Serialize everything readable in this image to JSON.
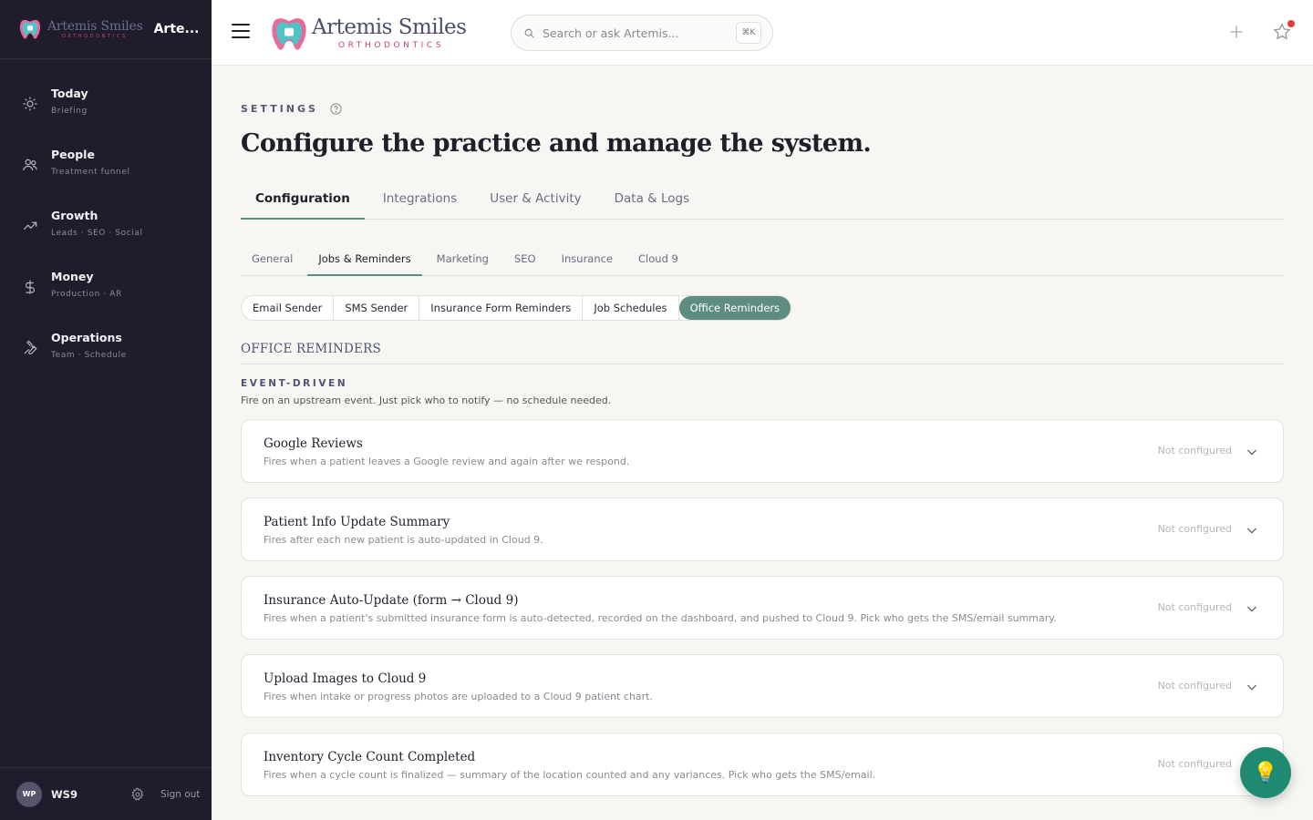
{
  "brand": {
    "logo_name": "Artemis Smiles",
    "logo_tagline": "ORTHODONTICS",
    "app_name": "Arte...",
    "colors": {
      "accent": "#5d8c83",
      "sidebar_bg": "#1f1d2b",
      "brand_pink": "#c8426f",
      "fab": "#1e8a72"
    }
  },
  "sidebar": {
    "items": [
      {
        "label": "Today",
        "sub": "Briefing",
        "icon": "sun-icon"
      },
      {
        "label": "People",
        "sub": "Treatment funnel",
        "icon": "people-icon"
      },
      {
        "label": "Growth",
        "sub": "Leads · SEO · Social",
        "icon": "trending-up-icon"
      },
      {
        "label": "Money",
        "sub": "Production · AR",
        "icon": "dollar-icon"
      },
      {
        "label": "Operations",
        "sub": "Team · Schedule",
        "icon": "wrench-icon"
      }
    ],
    "user": {
      "initials": "WP",
      "name": "WS9",
      "signout": "Sign out"
    }
  },
  "topbar": {
    "search_placeholder": "Search or ask Artemis...",
    "shortcut": "⌘K"
  },
  "page": {
    "overline": "SETTINGS",
    "title": "Configure the practice and manage the system."
  },
  "tabs": [
    "Configuration",
    "Integrations",
    "User & Activity",
    "Data & Logs"
  ],
  "subtabs": [
    "General",
    "Jobs & Reminders",
    "Marketing",
    "SEO",
    "Insurance",
    "Cloud 9"
  ],
  "segments": [
    "Email Sender",
    "SMS Sender",
    "Insurance Form Reminders",
    "Job Schedules",
    "Office Reminders"
  ],
  "section": {
    "title": "OFFICE REMINDERS",
    "group_label": "EVENT-DRIVEN",
    "group_desc": "Fire on an upstream event. Just pick who to notify — no schedule needed."
  },
  "cards": [
    {
      "title": "Google Reviews",
      "desc": "Fires when a patient leaves a Google review and again after we respond.",
      "status": "Not configured"
    },
    {
      "title": "Patient Info Update Summary",
      "desc": "Fires after each new patient is auto-updated in Cloud 9.",
      "status": "Not configured"
    },
    {
      "title": "Insurance Auto-Update (form → Cloud 9)",
      "desc": "Fires when a patient's submitted insurance form is auto-detected, recorded on the dashboard, and pushed to Cloud 9. Pick who gets the SMS/email summary.",
      "status": "Not configured"
    },
    {
      "title": "Upload Images to Cloud 9",
      "desc": "Fires when intake or progress photos are uploaded to a Cloud 9 patient chart.",
      "status": "Not configured"
    },
    {
      "title": "Inventory Cycle Count Completed",
      "desc": "Fires when a cycle count is finalized — summary of the location counted and any variances. Pick who gets the SMS/email.",
      "status": "Not configured"
    }
  ]
}
